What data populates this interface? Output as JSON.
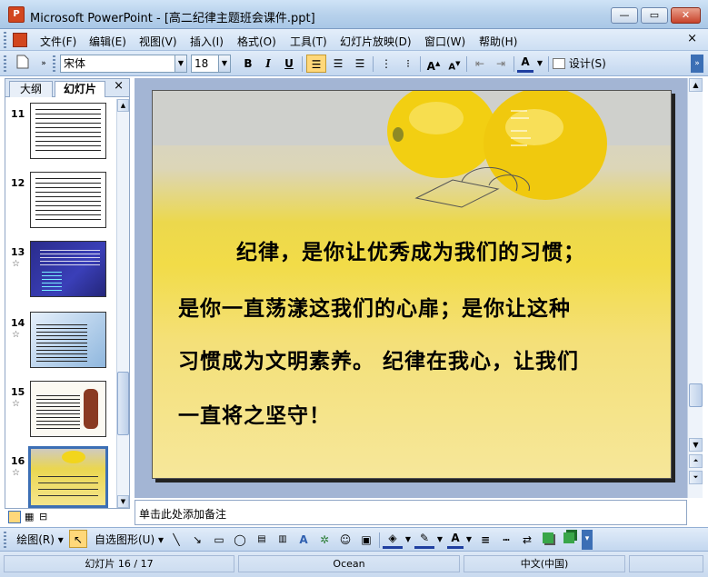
{
  "window": {
    "app_icon": "P",
    "title": "Microsoft PowerPoint - [高二纪律主题班会课件.ppt]",
    "minimize_label": "—",
    "maximize_label": "▭",
    "close_label": "✕"
  },
  "menu": {
    "items": [
      "文件(F)",
      "编辑(E)",
      "视图(V)",
      "插入(I)",
      "格式(O)",
      "工具(T)",
      "幻灯片放映(D)",
      "窗口(W)",
      "帮助(H)"
    ],
    "doc_close": "×"
  },
  "toolbar": {
    "font_name": "宋体",
    "font_size": "18",
    "bold": "B",
    "italic": "I",
    "underline": "U",
    "design_label": "设计(S)"
  },
  "left_pane": {
    "tabs": [
      "大纲",
      "幻灯片"
    ],
    "close": "×",
    "thumbnails": [
      {
        "number": "11",
        "star": ""
      },
      {
        "number": "12",
        "star": ""
      },
      {
        "number": "13",
        "star": "☆"
      },
      {
        "number": "14",
        "star": "☆"
      },
      {
        "number": "15",
        "star": "☆"
      },
      {
        "number": "16",
        "star": "☆"
      }
    ]
  },
  "slide": {
    "lines": [
      "纪律，是你让优秀成为我们的习惯；",
      "是你一直荡漾这我们的心扉；是你让这种",
      "习惯成为文明素养。 纪律在我心，让我们",
      "一直将之坚守！"
    ]
  },
  "notes": {
    "placeholder": "单击此处添加备注"
  },
  "drawbar": {
    "draw_label": "绘图(R)",
    "autoshape_label": "自选图形(U)"
  },
  "status": {
    "slide_position": "幻灯片 16 / 17",
    "theme": "Ocean",
    "language": "中文(中国)"
  }
}
